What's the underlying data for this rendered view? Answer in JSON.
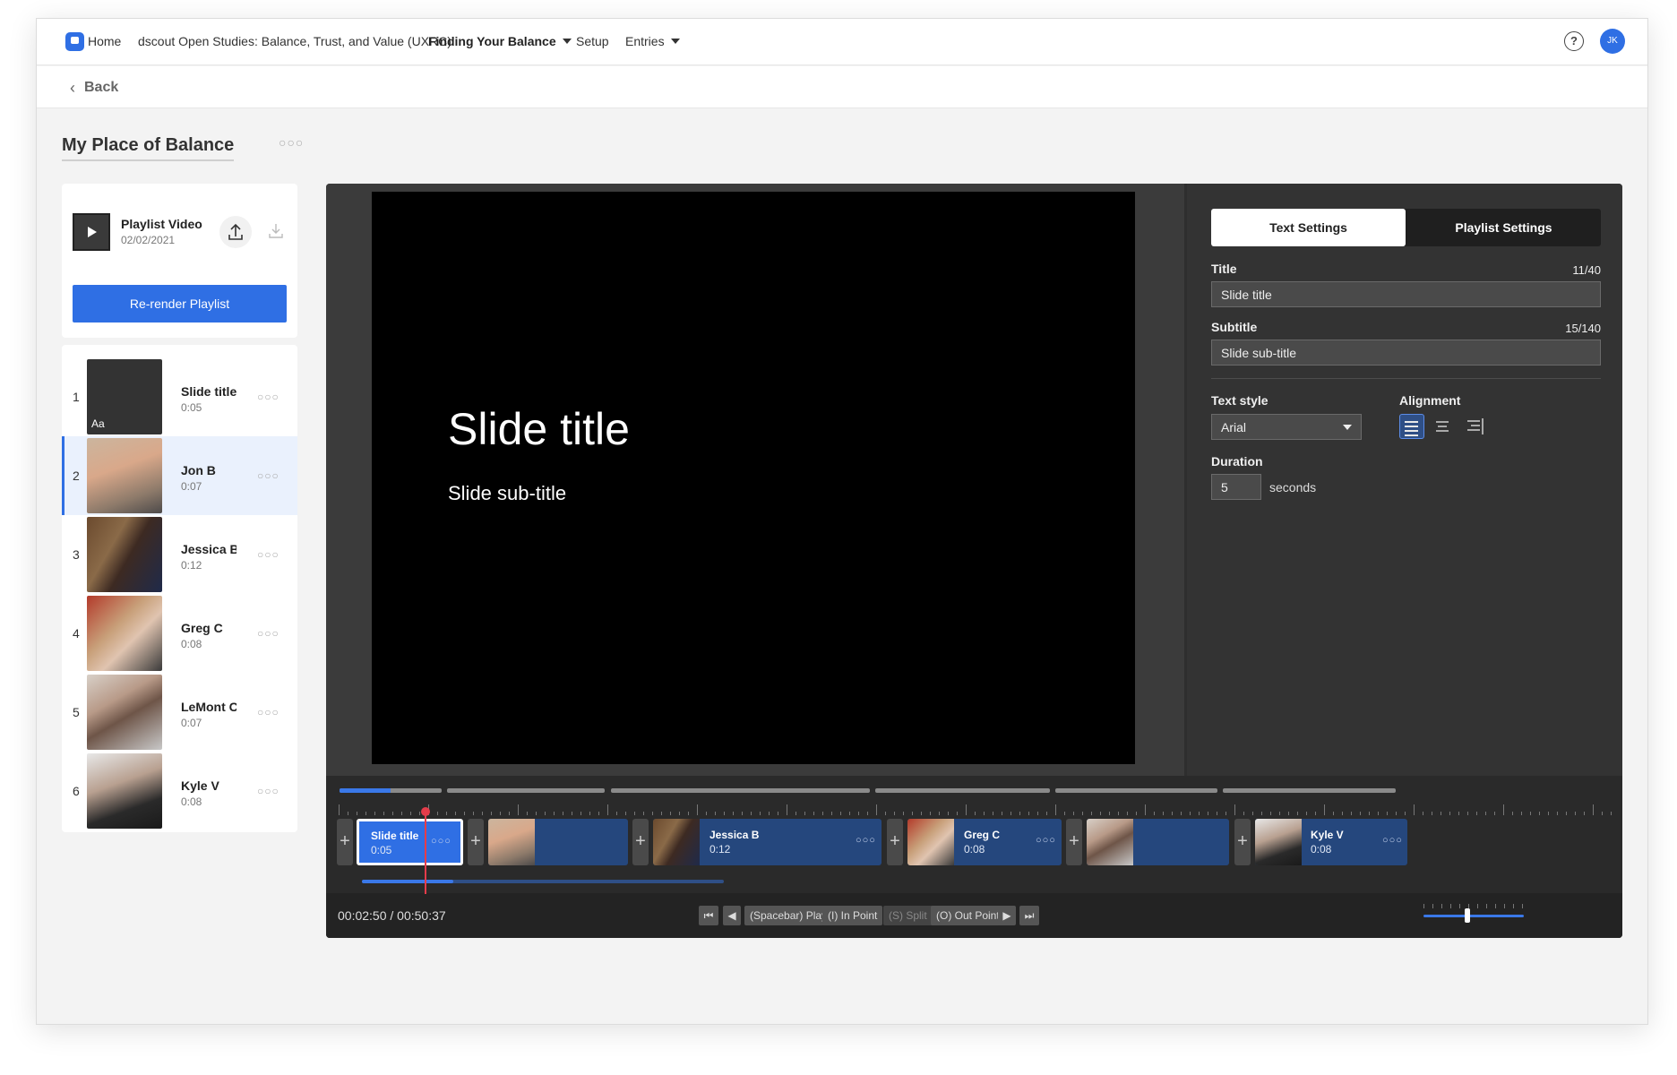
{
  "nav": {
    "home": "Home",
    "study": "dscout Open Studies: Balance, Trust, and Value (UXRC)",
    "mission": "Finding Your Balance",
    "setup": "Setup",
    "entries": "Entries",
    "help_symbol": "?",
    "avatar_initials": "JK"
  },
  "back_label": "Back",
  "page_title": "My Place of Balance",
  "more_symbol": "○○○",
  "playlist_video": {
    "title": "Playlist Video",
    "date": "02/02/2021",
    "rerender_label": "Re-render Playlist"
  },
  "playlist": [
    {
      "num": "1",
      "name": "Slide title",
      "duration": "0:05",
      "thumb_text": "Aa"
    },
    {
      "num": "2",
      "name": "Jon B",
      "duration": "0:07"
    },
    {
      "num": "3",
      "name": "Jessica B",
      "duration": "0:12"
    },
    {
      "num": "4",
      "name": "Greg C",
      "duration": "0:08"
    },
    {
      "num": "5",
      "name": "LeMont C",
      "duration": "0:07"
    },
    {
      "num": "6",
      "name": "Kyle V",
      "duration": "0:08"
    }
  ],
  "preview": {
    "title": "Slide title",
    "subtitle": "Slide sub-title"
  },
  "settings": {
    "tab_text": "Text Settings",
    "tab_playlist": "Playlist Settings",
    "title_label": "Title",
    "title_count": "11/40",
    "title_value": "Slide title",
    "subtitle_label": "Subtitle",
    "subtitle_count": "15/140",
    "subtitle_value": "Slide sub-title",
    "text_style_label": "Text style",
    "text_style_value": "Arial",
    "alignment_label": "Alignment",
    "alignment_selected": "left",
    "duration_label": "Duration",
    "duration_value": "5",
    "duration_unit": "seconds"
  },
  "timeline": {
    "clips": [
      {
        "name": "Slide title",
        "duration": "0:05",
        "selected": true
      },
      {
        "name": "",
        "duration": ""
      },
      {
        "name": "Jessica B",
        "duration": "0:12"
      },
      {
        "name": "Greg C",
        "duration": "0:08"
      },
      {
        "name": "",
        "duration": ""
      },
      {
        "name": "Kyle V",
        "duration": "0:08"
      }
    ],
    "add_symbol": "+",
    "timecode": "00:02:50 / 00:50:37",
    "controls": {
      "play": "(Spacebar) Play",
      "in_point": "(I) In Point",
      "split": "(S) Split",
      "out_point": "(O) Out Point"
    }
  },
  "colors": {
    "accent": "#2f6fe4",
    "playhead": "#e53c4a",
    "clip": "#25477d"
  }
}
